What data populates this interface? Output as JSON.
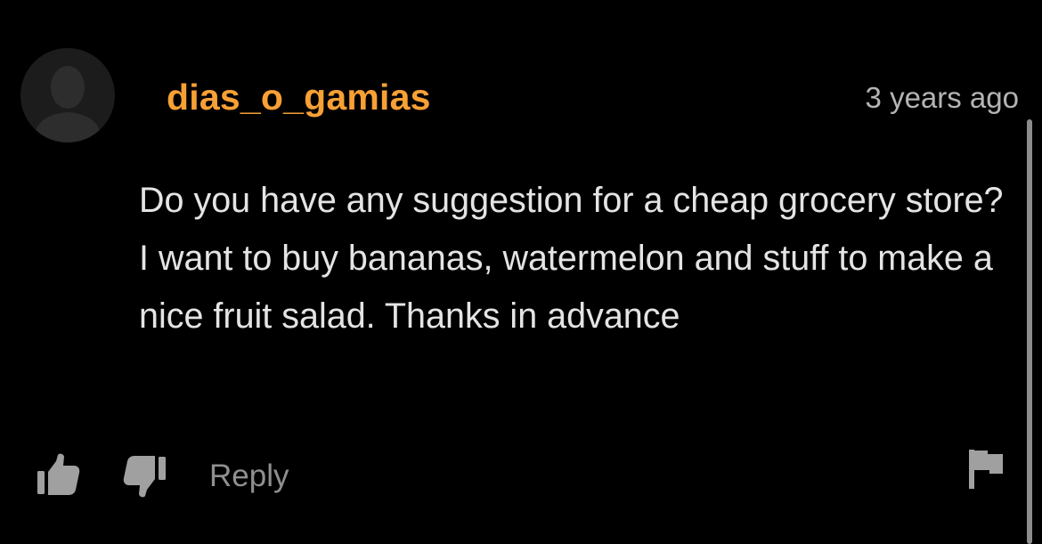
{
  "comment": {
    "username": "dias_o_gamias",
    "timestamp": "3 years ago",
    "body": "Do you have any suggestion for a cheap grocery store? I want to buy bananas, watermelon and stuff to make a nice fruit salad. Thanks in advance"
  },
  "actions": {
    "reply_label": "Reply",
    "like_icon": "thumbs-up-icon",
    "dislike_icon": "thumbs-down-icon",
    "report_icon": "flag-icon"
  },
  "colors": {
    "background": "#000000",
    "username": "#f7a034",
    "body_text": "#e4e4e4",
    "timestamp": "#b4b4b4",
    "action_icons": "#a0a0a0",
    "reply_text": "#8f8f8f",
    "avatar_bg": "#1c1c1c",
    "avatar_silhouette": "#2d2d2d"
  }
}
